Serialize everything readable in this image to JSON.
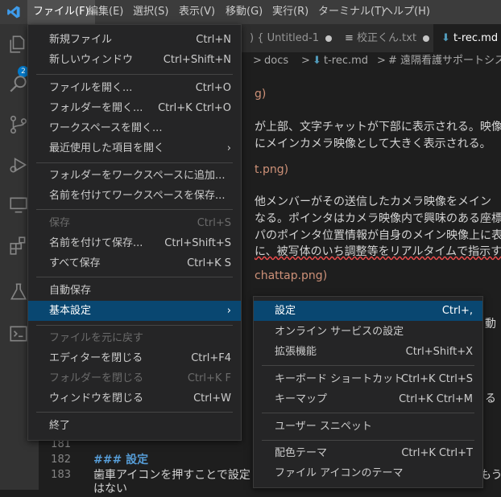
{
  "menubar": {
    "items": [
      {
        "label": "ファイル(F)"
      },
      {
        "label": "編集(E)"
      },
      {
        "label": "選択(S)"
      },
      {
        "label": "表示(V)"
      },
      {
        "label": "移動(G)"
      },
      {
        "label": "実行(R)"
      },
      {
        "label": "ターミナル(T)"
      },
      {
        "label": "ヘルプ(H)"
      }
    ]
  },
  "activity": {
    "badge": "2"
  },
  "tabs": [
    {
      "label": ") { Untitled-1"
    },
    {
      "label": "校正くん.txt"
    },
    {
      "label": "t-rec.md"
    }
  ],
  "breadcrumb": {
    "sep1": ">",
    "docs": "docs",
    "sep2": ">",
    "file": "t-rec.md",
    "sep3": ">",
    "heading": "# 遠隔看護サポートシステム"
  },
  "editor": {
    "lines": [
      "g)",
      "が上部、文字チャットが下部に表示される。映像",
      "にメインカメラ映像として大きく表示される。",
      "t.png)",
      "他メンバーがその送信したカメラ映像をメイン",
      "なる。ポインタはカメラ映像内で興味のある座標",
      "パのポインタ位置情報が自身のメイン映像上に表",
      "に、被写体のいち調整等をリアルタイムで指示す",
      "chattap.png)",
      "動",
      "る"
    ],
    "line_numbers": [
      "181",
      "182",
      "183"
    ],
    "line182": "### 設定",
    "line183": "歯車アイコンを押すことで設定",
    "line183_tail": "もう",
    "line184": "はない"
  },
  "file_menu": {
    "items": [
      {
        "label": "新規ファイル",
        "key": "Ctrl+N"
      },
      {
        "label": "新しいウィンドウ",
        "key": "Ctrl+Shift+N"
      },
      {
        "label": "ファイルを開く...",
        "key": "Ctrl+O"
      },
      {
        "label": "フォルダーを開く...",
        "key": "Ctrl+K Ctrl+O"
      },
      {
        "label": "ワークスペースを開く...",
        "key": ""
      },
      {
        "label": "最近使用した項目を開く",
        "key": ""
      },
      {
        "label": "フォルダーをワークスペースに追加...",
        "key": ""
      },
      {
        "label": "名前を付けてワークスペースを保存...",
        "key": ""
      },
      {
        "label": "保存",
        "key": "Ctrl+S"
      },
      {
        "label": "名前を付けて保存...",
        "key": "Ctrl+Shift+S"
      },
      {
        "label": "すべて保存",
        "key": "Ctrl+K S"
      },
      {
        "label": "自動保存",
        "key": ""
      },
      {
        "label": "基本設定",
        "key": ""
      },
      {
        "label": "ファイルを元に戻す",
        "key": ""
      },
      {
        "label": "エディターを閉じる",
        "key": "Ctrl+F4"
      },
      {
        "label": "フォルダーを閉じる",
        "key": "Ctrl+K F"
      },
      {
        "label": "ウィンドウを閉じる",
        "key": "Ctrl+W"
      },
      {
        "label": "終了",
        "key": ""
      }
    ]
  },
  "prefs_menu": {
    "items": [
      {
        "label": "設定",
        "key": "Ctrl+,"
      },
      {
        "label": "オンライン サービスの設定",
        "key": ""
      },
      {
        "label": "拡張機能",
        "key": "Ctrl+Shift+X"
      },
      {
        "label": "キーボード ショートカット",
        "key": "Ctrl+K Ctrl+S"
      },
      {
        "label": "キーマップ",
        "key": "Ctrl+K Ctrl+M"
      },
      {
        "label": "ユーザー スニペット",
        "key": ""
      },
      {
        "label": "配色テーマ",
        "key": "Ctrl+K Ctrl+T"
      },
      {
        "label": "ファイル アイコンのテーマ",
        "key": ""
      }
    ]
  },
  "colors": {
    "accent": "#007acc",
    "selection": "#094771",
    "menu_bg": "#252526"
  }
}
